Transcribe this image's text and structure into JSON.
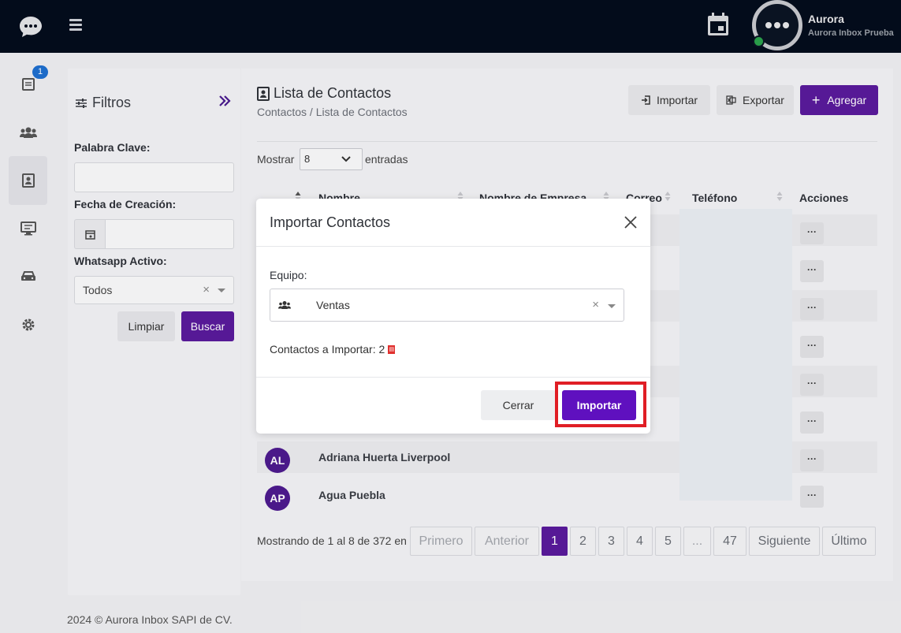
{
  "app": {
    "user_name": "Aurora",
    "user_subtitle": "Aurora Inbox Prueba",
    "notification_count": "1"
  },
  "filters": {
    "title": "Filtros",
    "keyword_label": "Palabra Clave:",
    "keyword_value": "",
    "date_label": "Fecha de Creación:",
    "date_value": "",
    "whatsapp_label": "Whatsapp Activo:",
    "whatsapp_value": "Todos",
    "clear_label": "Limpiar",
    "search_label": "Buscar"
  },
  "main": {
    "title": "Lista de Contactos",
    "breadcrumb": "Contactos  /  Lista de Contactos",
    "import_label": "Importar",
    "export_label": "Exportar",
    "add_label": "Agregar",
    "show_label": "Mostrar",
    "show_value": "8",
    "show_after": "entradas",
    "columns": [
      "Nombre",
      "Nombre de Empresa",
      "Correo",
      "Teléfono",
      "Acciones"
    ],
    "rows": [
      {
        "initials": "AL",
        "name": "Adriana Huerta Liverpool"
      },
      {
        "initials": "AP",
        "name": "Agua Puebla"
      }
    ],
    "actions_label": "···",
    "showing_text": "Mostrando de 1 al 8 de 372 en",
    "pagination": [
      "Primero",
      "Anterior",
      "1",
      "2",
      "3",
      "4",
      "5",
      "...",
      "47",
      "Siguiente",
      "Último"
    ],
    "current_page": "1"
  },
  "modal": {
    "title": "Importar Contactos",
    "team_label": "Equipo:",
    "team_value": "Ventas",
    "count_text": "Contactos a Importar: 2",
    "close_label": "Cerrar",
    "import_label": "Importar"
  },
  "footer": {
    "text": "2024 © Aurora Inbox SAPI de CV."
  },
  "colors": {
    "brand_purple": "#5a1a9c",
    "topbar": "#040d1c",
    "highlight_red": "#e01e25"
  }
}
